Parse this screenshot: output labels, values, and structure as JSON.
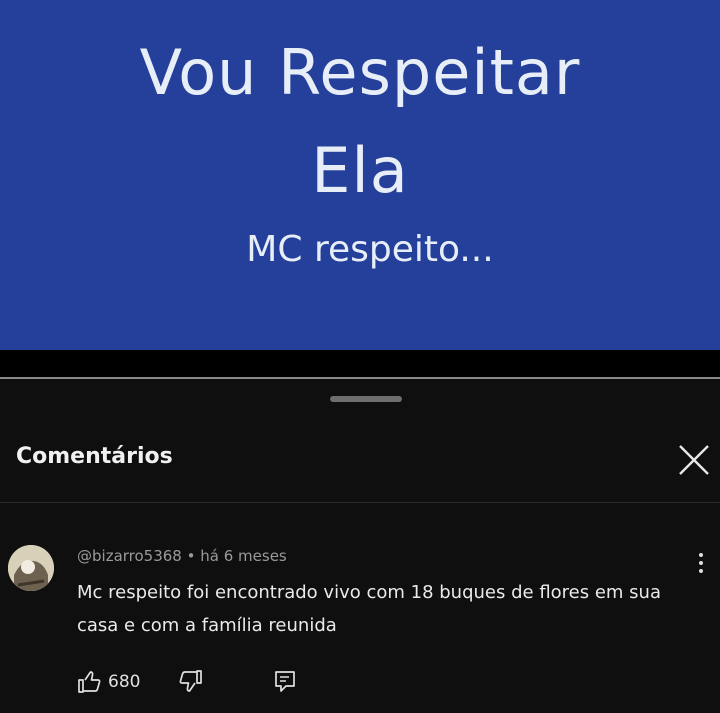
{
  "video": {
    "title_line1": "Vou Respeitar",
    "title_line2": "Ela",
    "subtitle": "MC respeito...",
    "background_color": "#24409a"
  },
  "panel": {
    "title": "Comentários",
    "close_icon": "close-icon"
  },
  "comment": {
    "author": "@bizarro5368",
    "time": "há 6 meses",
    "text": "Mc respeito foi encontrado vivo com 18 buques de flores em sua casa e com a família reunida",
    "likes": "680",
    "icons": [
      "thumbs-up-icon",
      "thumbs-down-icon",
      "reply-icon",
      "more-vertical-icon"
    ]
  }
}
